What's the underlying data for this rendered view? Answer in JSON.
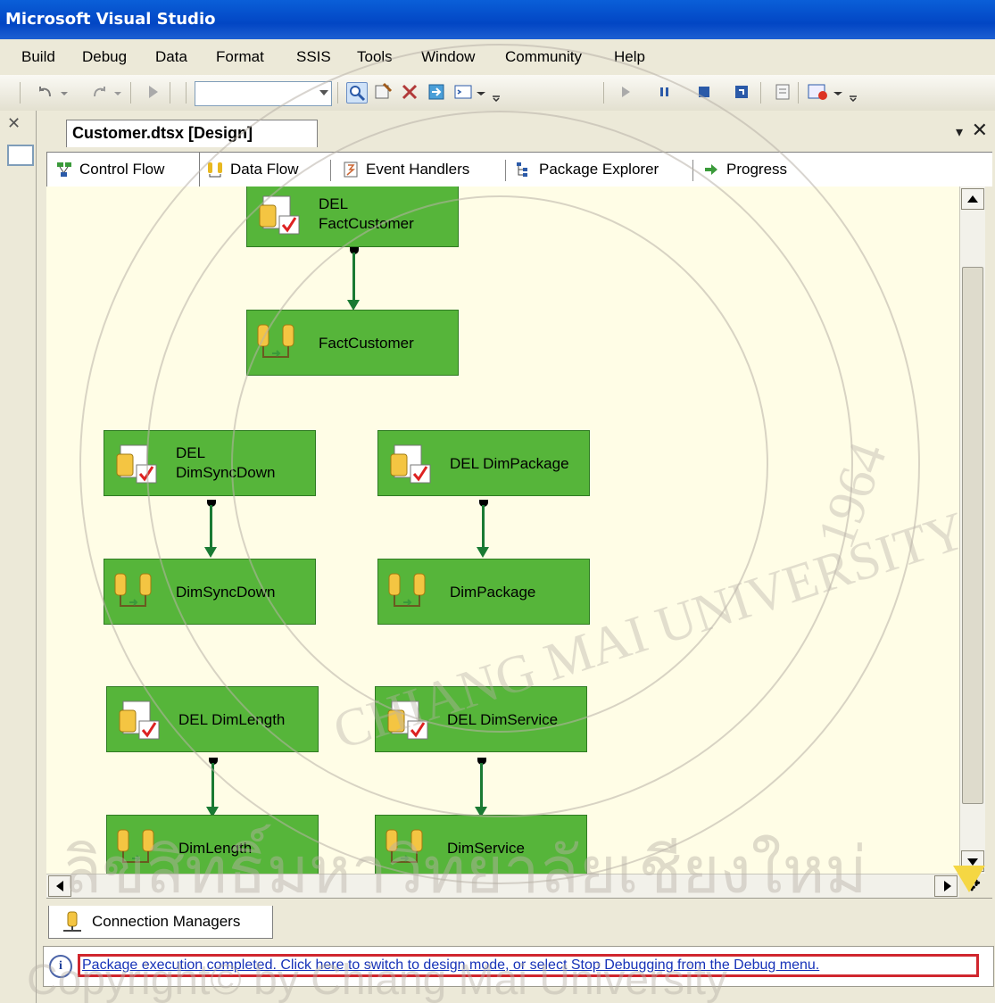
{
  "window": {
    "title": "Microsoft Visual Studio"
  },
  "menu": [
    "Build",
    "Debug",
    "Data",
    "Format",
    "SSIS",
    "Tools",
    "Window",
    "Community",
    "Help"
  ],
  "document": {
    "tab_title": "Customer.dtsx [Design]"
  },
  "designer_tabs": [
    {
      "label": "Control Flow",
      "icon": "control-flow-icon",
      "active": true
    },
    {
      "label": "Data Flow",
      "icon": "data-flow-icon",
      "active": false
    },
    {
      "label": "Event Handlers",
      "icon": "event-handlers-icon",
      "active": false
    },
    {
      "label": "Package Explorer",
      "icon": "package-explorer-icon",
      "active": false
    },
    {
      "label": "Progress",
      "icon": "progress-arrow-icon",
      "active": false
    }
  ],
  "tasks": [
    {
      "label": "DEL\nFactCustomer",
      "type": "execute-sql"
    },
    {
      "label": "FactCustomer",
      "type": "data-flow"
    },
    {
      "label": "DEL\nDimSyncDown",
      "type": "execute-sql"
    },
    {
      "label": "DimSyncDown",
      "type": "data-flow"
    },
    {
      "label": "DEL DimPackage",
      "type": "execute-sql"
    },
    {
      "label": "DimPackage",
      "type": "data-flow"
    },
    {
      "label": "DEL DimLength",
      "type": "execute-sql"
    },
    {
      "label": "DimLength",
      "type": "data-flow"
    },
    {
      "label": "DEL DimService",
      "type": "execute-sql"
    },
    {
      "label": "DimService",
      "type": "data-flow"
    }
  ],
  "connection_managers": {
    "label": "Connection Managers"
  },
  "info_bar": {
    "message": "Package execution completed. Click here to switch to design mode, or select Stop Debugging from the Debug menu."
  },
  "colors": {
    "task_success": "#56b53a",
    "connector": "#1a7a33",
    "canvas": "#fffde6",
    "title_bar": "#0a5fd8",
    "highlight": "#d0262e"
  },
  "watermark": {
    "university_text": "CHIANG MAI UNIVERSITY",
    "year": "1964",
    "thai_text": "ลิขสิทธิ์มหาวิทยาลัยเชียงใหม่",
    "copyright_text": "Copyright© by Chiang Mai University"
  }
}
